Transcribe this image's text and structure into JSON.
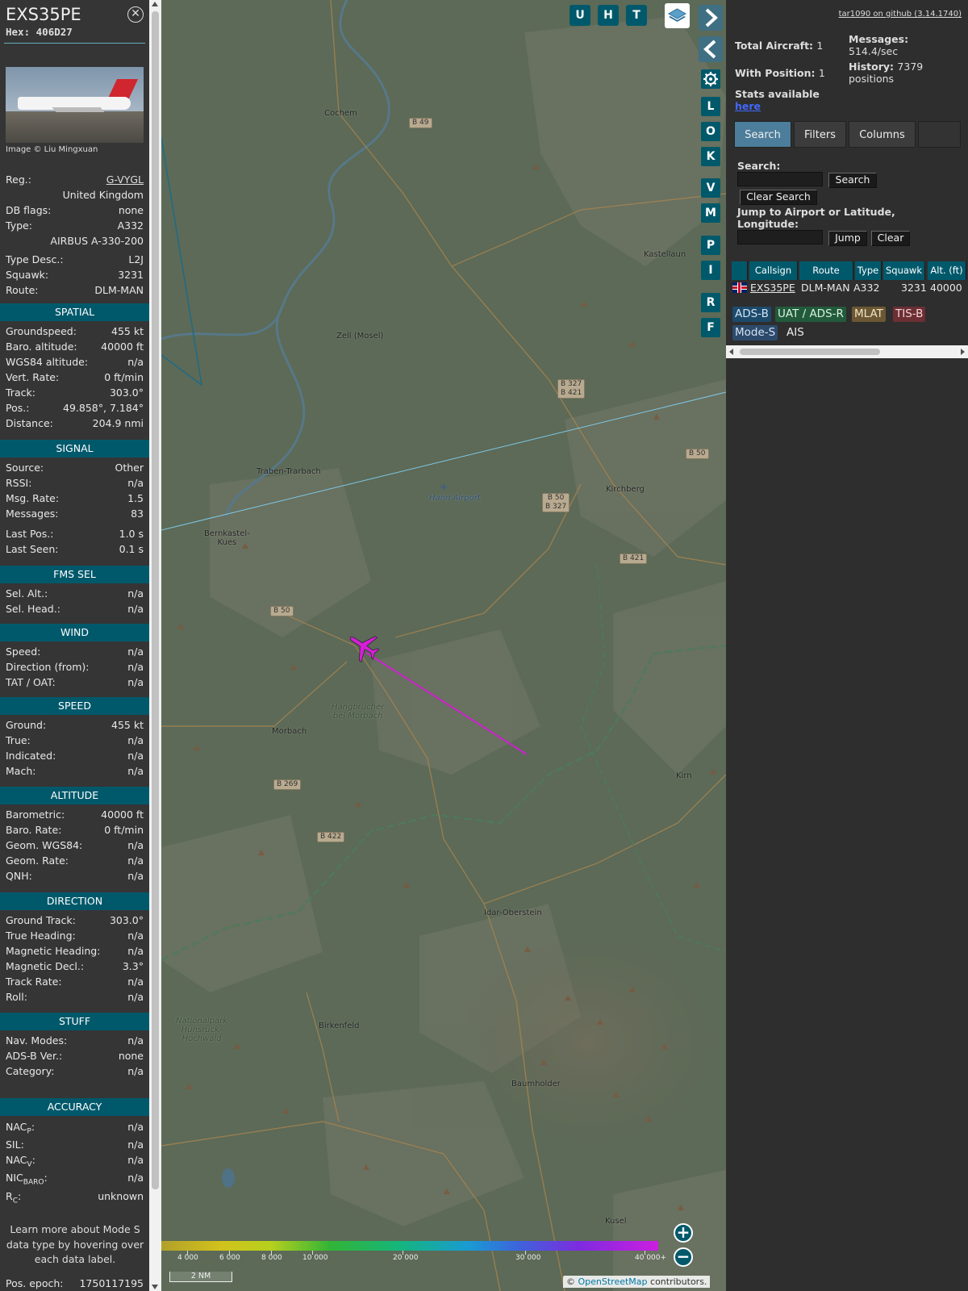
{
  "sidebar": {
    "callsign": "EXS35PE",
    "hex_label": "Hex:",
    "hex": "406D27",
    "photo_credit": "Image © Liu Mingxuan",
    "close_label": "✕",
    "info_rows": [
      {
        "label": "Reg.:",
        "value": "G-VYGL"
      },
      {
        "label": "",
        "value": "United Kingdom"
      },
      {
        "label": "DB flags:",
        "value": "none"
      },
      {
        "label": "Type:",
        "value": "A332"
      },
      {
        "label": "",
        "value": "AIRBUS A-330-200"
      },
      {
        "label": "Type Desc.:",
        "value": "L2J"
      },
      {
        "label": "Squawk:",
        "value": "3231"
      },
      {
        "label": "Route:",
        "value": "DLM-MAN"
      }
    ],
    "sections": {
      "spatial": {
        "title": "SPATIAL",
        "rows": [
          {
            "label": "Groundspeed:",
            "value": "455 kt"
          },
          {
            "label": "Baro. altitude:",
            "value": "40000 ft"
          },
          {
            "label": "WGS84 altitude:",
            "value": "n/a"
          },
          {
            "label": "Vert. Rate:",
            "value": "0 ft/min"
          },
          {
            "label": "Track:",
            "value": "303.0°"
          },
          {
            "label": "Pos.:",
            "value": "49.858°, 7.184°"
          },
          {
            "label": "Distance:",
            "value": "204.9 nmi"
          }
        ]
      },
      "signal": {
        "title": "SIGNAL",
        "rows": [
          {
            "label": "Source:",
            "value": "Other"
          },
          {
            "label": "RSSI:",
            "value": "n/a"
          },
          {
            "label": "Msg. Rate:",
            "value": "1.5"
          },
          {
            "label": "Messages:",
            "value": "83"
          },
          {
            "label": "Last Pos.:",
            "value": "1.0 s"
          },
          {
            "label": "Last Seen:",
            "value": "0.1 s"
          }
        ]
      },
      "fms": {
        "title": "FMS SEL",
        "rows": [
          {
            "label": "Sel. Alt.:",
            "value": "n/a"
          },
          {
            "label": "Sel. Head.:",
            "value": "n/a"
          }
        ]
      },
      "wind": {
        "title": "WIND",
        "rows": [
          {
            "label": "Speed:",
            "value": "n/a"
          },
          {
            "label": "Direction (from):",
            "value": "n/a"
          },
          {
            "label": "TAT / OAT:",
            "value": "n/a"
          }
        ]
      },
      "speed": {
        "title": "SPEED",
        "rows": [
          {
            "label": "Ground:",
            "value": "455 kt"
          },
          {
            "label": "True:",
            "value": "n/a"
          },
          {
            "label": "Indicated:",
            "value": "n/a"
          },
          {
            "label": "Mach:",
            "value": "n/a"
          }
        ]
      },
      "altitude": {
        "title": "ALTITUDE",
        "rows": [
          {
            "label": "Barometric:",
            "value": "40000 ft"
          },
          {
            "label": "Baro. Rate:",
            "value": "0 ft/min"
          },
          {
            "label": "Geom. WGS84:",
            "value": "n/a"
          },
          {
            "label": "Geom. Rate:",
            "value": "n/a"
          },
          {
            "label": "QNH:",
            "value": "n/a"
          }
        ]
      },
      "direction": {
        "title": "DIRECTION",
        "rows": [
          {
            "label": "Ground Track:",
            "value": "303.0°"
          },
          {
            "label": "True Heading:",
            "value": "n/a"
          },
          {
            "label": "Magnetic Heading:",
            "value": "n/a"
          },
          {
            "label": "Magnetic Decl.:",
            "value": "3.3°"
          },
          {
            "label": "Track Rate:",
            "value": "n/a"
          },
          {
            "label": "Roll:",
            "value": "n/a"
          }
        ]
      },
      "stuff": {
        "title": "STUFF",
        "rows": [
          {
            "label": "Nav. Modes:",
            "value": "n/a"
          },
          {
            "label": "ADS-B Ver.:",
            "value": "none"
          },
          {
            "label": "Category:",
            "value": "n/a"
          }
        ]
      },
      "accuracy": {
        "title": "ACCURACY",
        "rows": [
          {
            "label": "NAC",
            "sub": "P",
            "value": "n/a"
          },
          {
            "label": "SIL:",
            "sub": "",
            "value": "n/a"
          },
          {
            "label": "NAC",
            "sub": "V",
            "value": "n/a"
          },
          {
            "label": "NIC",
            "sub": "BARO",
            "value": "n/a"
          },
          {
            "label": "R",
            "sub": "C",
            "value": "unknown"
          }
        ]
      }
    },
    "footnote": "Learn more about Mode S data type by hovering over each data label.",
    "epoch_label": "Pos. epoch:",
    "epoch_value": "1750117195"
  },
  "map": {
    "top_buttons": [
      "U",
      "H",
      "T"
    ],
    "side_buttons": [
      "L",
      "O",
      "K",
      "V",
      "M",
      "P",
      "I",
      "R",
      "F"
    ],
    "places": {
      "cochem": "Cochem",
      "kastellaun": "Kastellaun",
      "zell": "Zell (Mosel)",
      "traben": "Traben-Trarbach",
      "hahn": "Hahn Airport",
      "kirchberg": "Kirchberg",
      "bernkastel": "Bernkastel-\nKues",
      "hangbrucher": "Hangbrucher\nbei Morbach",
      "morbach": "Morbach",
      "kirn": "Kirn",
      "idar": "Idar-Oberstein",
      "nationalpark": "Nationalpark\nHunsrück-\nHochwald",
      "birkenfeld": "Birkenfeld",
      "baumholder": "Baumholder",
      "kusel": "Kusel"
    },
    "roads": {
      "b49": "B 49",
      "b327_421": "B 327\nB 421",
      "b50_a": "B 50",
      "b50_327": "B 50\nB 327",
      "b421": "B 421",
      "b50_b": "B 50",
      "b269": "B 269",
      "b422": "B 422"
    },
    "altitude_legend": [
      "4 000",
      "6 000",
      "8 000",
      "10 000",
      "20 000",
      "30 000",
      "40 000+"
    ],
    "scale_label": "2 NM",
    "attribution_prefix": "©",
    "attribution_link": "OpenStreetMap",
    "attribution_suffix": "contributors."
  },
  "panel": {
    "github_link": "tar1090 on github (3.14.1740)",
    "total_aircraft_label": "Total Aircraft:",
    "total_aircraft": "1",
    "messages_label": "Messages:",
    "messages_value": "514.4/sec",
    "with_position_label": "With Position:",
    "with_position": "1",
    "history_label": "History:",
    "history_value": "7379",
    "history_unit": "positions",
    "stats_label": "Stats available",
    "stats_link": "here",
    "tabs": [
      "Search",
      "Filters",
      "Columns"
    ],
    "search_label": "Search:",
    "search_button": "Search",
    "clear_search_button": "Clear Search",
    "jump_label": "Jump to Airport or Latitude, Longitude:",
    "jump_button": "Jump",
    "clear_button": "Clear",
    "table": {
      "columns": [
        "",
        "Callsign",
        "Route",
        "Type",
        "Squawk",
        "Alt. (ft)"
      ],
      "rows": [
        {
          "callsign": "EXS35PE",
          "route": "DLM-MAN",
          "type": "A332",
          "squawk": "3231",
          "alt": "40000"
        }
      ]
    },
    "badges": [
      {
        "label": "ADS-B",
        "bg": "#1d4a6b",
        "fg": "#cfe3f5"
      },
      {
        "label": "UAT / ADS-R",
        "bg": "#225a3c",
        "fg": "#d6f1dd"
      },
      {
        "label": "MLAT",
        "bg": "#6b5733",
        "fg": "#f2e4c6"
      },
      {
        "label": "TIS-B",
        "bg": "#6b2f34",
        "fg": "#f5d3d5"
      },
      {
        "label": "Mode-S",
        "bg": "#2d4a6b",
        "fg": "#d3e2f5"
      },
      {
        "label": "AIS",
        "bg": "#2e2e2e",
        "fg": "#eee"
      }
    ]
  },
  "colors": {
    "accent": "#00596b",
    "track": "#cc22cc",
    "aircraft": "#d41fd6"
  }
}
